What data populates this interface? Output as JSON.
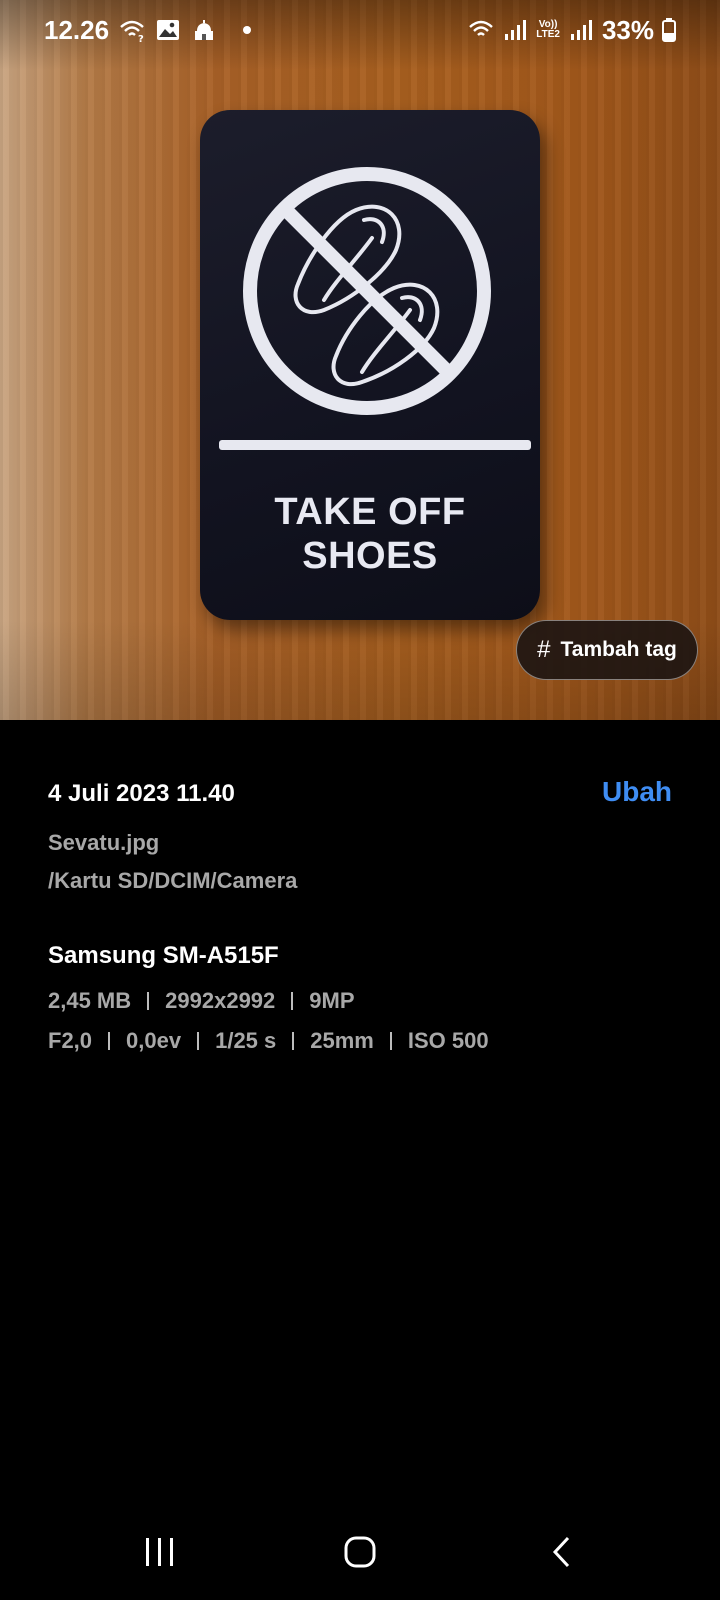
{
  "status_bar": {
    "time": "12.26",
    "left_icons": [
      "wifi-question-icon",
      "gallery-icon",
      "mosque-icon",
      "notification-dot"
    ],
    "right_icons": [
      "wifi-icon",
      "signal-icon",
      "volte-lte2-icon",
      "signal-icon",
      "battery-icon"
    ],
    "volte_top": "Vo))",
    "volte_bottom": "LTE2",
    "battery": "33%"
  },
  "photo": {
    "sign_line1": "TAKE OFF",
    "sign_line2": "SHOES"
  },
  "tag_button": {
    "icon": "hash-icon",
    "label": "Tambah tag"
  },
  "details": {
    "date": "4 Juli 2023 11.40",
    "edit_label": "Ubah",
    "filename": "Sevatu.jpg",
    "path": "/Kartu SD/DCIM/Camera",
    "device": "Samsung SM-A515F",
    "file_info": [
      "2,45 MB",
      "2992x2992",
      "9MP"
    ],
    "camera_info": [
      "F2,0",
      "0,0ev",
      "1/25 s",
      "25mm",
      "ISO 500"
    ]
  },
  "colors": {
    "accent": "#3f8df3",
    "secondary_text": "#a8a8a8",
    "background": "#000000"
  },
  "nav_bar": {
    "buttons": [
      "recent-apps-icon",
      "home-icon",
      "back-icon"
    ]
  }
}
